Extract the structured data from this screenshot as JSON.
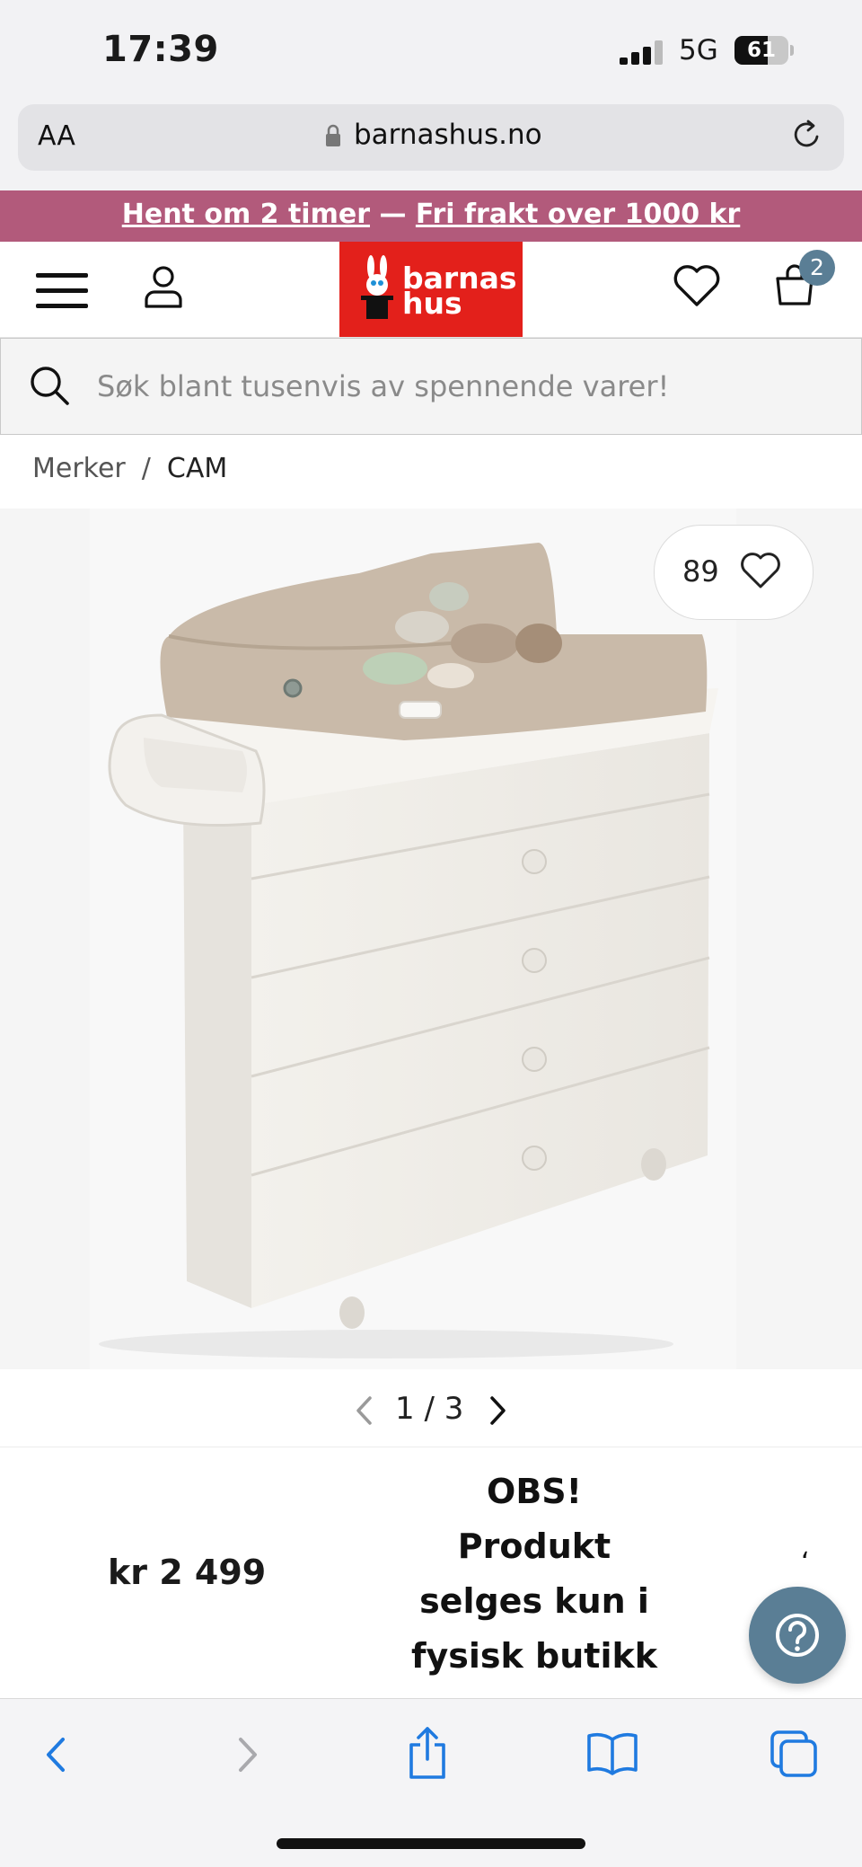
{
  "status_bar": {
    "time": "17:39",
    "network": "5G",
    "battery": "61",
    "battery_level": 0.61
  },
  "browser": {
    "text_size_label": "AA",
    "url": "barnashus.no"
  },
  "promo": {
    "part1": "Hent om 2 timer",
    "separator": " — ",
    "part2": "Fri frakt over 1000 kr"
  },
  "header": {
    "logo_line1": "barnas",
    "logo_line2": "hus",
    "cart_count": "2"
  },
  "search": {
    "placeholder": "Søk blant tusenvis av spennende varer!"
  },
  "breadcrumb": {
    "items": [
      "Merker",
      "CAM"
    ],
    "separator": "/"
  },
  "product": {
    "favorites_count": "89",
    "image_index": "1",
    "image_total": "3",
    "price": "kr 2 499",
    "notice_lines": [
      "OBS!",
      "Produkt",
      "selges kun i",
      "fysisk butikk"
    ]
  },
  "colors": {
    "promo_bg": "#b25a7b",
    "logo_bg": "#e3201b",
    "accent": "#5a7e95",
    "ios_blue": "#1f7ae0"
  }
}
